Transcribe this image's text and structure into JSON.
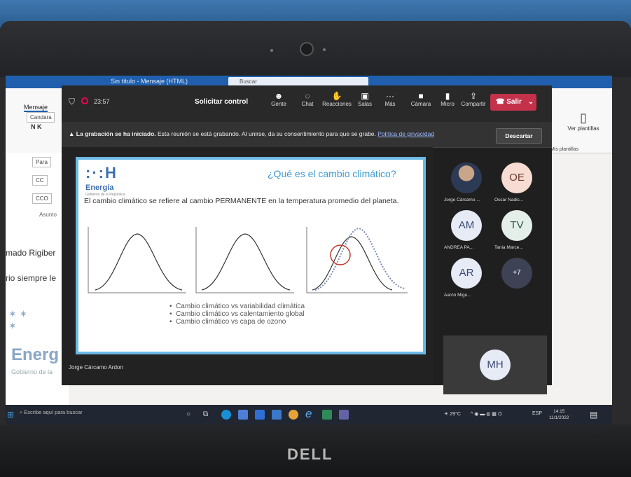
{
  "teams": {
    "timer": "23:57",
    "request_control": "Solicitar control",
    "toolbar": [
      {
        "icon": "people-icon",
        "label": "Gente"
      },
      {
        "icon": "chat-icon",
        "label": "Chat"
      },
      {
        "icon": "reactions-icon",
        "label": "Reacciones"
      },
      {
        "icon": "rooms-icon",
        "label": "Salas"
      },
      {
        "icon": "more-icon",
        "label": "Más"
      },
      {
        "icon": "camera-icon",
        "label": "Cámara"
      },
      {
        "icon": "mic-icon",
        "label": "Micro"
      },
      {
        "icon": "share-icon",
        "label": "Compartir"
      }
    ],
    "leave_label": "Salir",
    "banner": {
      "bold": "La grabación se ha iniciado.",
      "text": "Esta reunión se está grabando. Al unirse, da su consentimiento para que se grabe.",
      "link": "Política de privacidad",
      "dismiss": "Descartar"
    },
    "presenter_name": "Jorge Cárcamo Ardon",
    "participants": [
      {
        "initials": "",
        "name": "Jorge Cárcamo ..."
      },
      {
        "initials": "OE",
        "name": "Oscar Nadic..."
      },
      {
        "initials": "AM",
        "name": "ANDREA PA..."
      },
      {
        "initials": "TV",
        "name": "Tania Marce..."
      },
      {
        "initials": "AR",
        "name": "Aarón Migu..."
      },
      {
        "initials": "+7",
        "name": ""
      }
    ],
    "self_tile": "MH"
  },
  "slide": {
    "logo_mark": ":·:H",
    "logo_name": "Energía",
    "logo_sub": "Gobierno de la República",
    "title": "¿Qué es el cambio climático?",
    "body": "El cambio climático se refiere al cambio PERMANENTE en la temperatura promedio del planeta.",
    "bullets": [
      "Cambio climático vs variabilidad climática",
      "Cambio climático vs calentamiento global",
      "Cambio climático vs capa de ozono"
    ]
  },
  "outlook": {
    "title": "Sin título - Mensaje (HTML)",
    "search": "Buscar",
    "tab": "Mensaje",
    "font": "Candara",
    "fields": [
      "Para",
      "CC",
      "CCO",
      "Asunto"
    ],
    "body_line1": "mado Rigiber",
    "body_line2": "rio siempre le",
    "brand": "Energ",
    "brand_sub": "Gobierno de la",
    "right_buttons": [
      "Ver plantillas",
      "Mis plantillas"
    ]
  },
  "taskbar": {
    "search_placeholder": "Escribe aquí para buscar",
    "weather": "29°C",
    "lang": "ESP",
    "time": "14:15",
    "date": "11/1/2022"
  },
  "laptop": {
    "brand": "DELL"
  },
  "colors": {
    "teams_leave": "#c4314b",
    "slide_border": "#6bb9e6",
    "slide_title": "#3c9ad0",
    "taskbar": "#202732"
  }
}
